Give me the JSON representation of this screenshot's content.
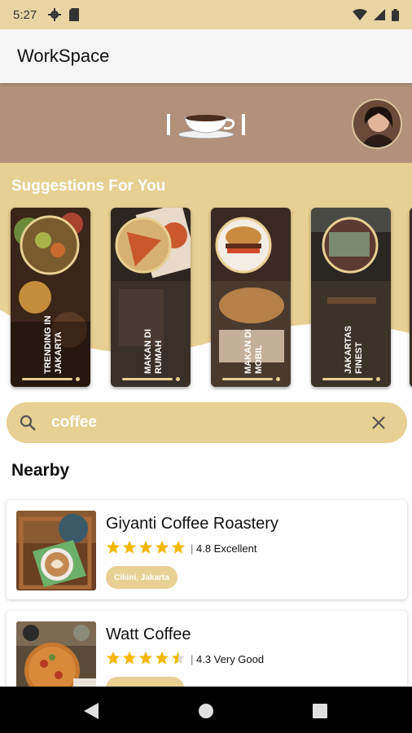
{
  "status_bar": {
    "time": "5:27",
    "left_icons": [
      "settings-icon",
      "sim-card-icon"
    ],
    "right_icons": [
      "wifi-icon",
      "signal-icon",
      "battery-icon"
    ]
  },
  "app_bar": {
    "title": "WorkSpace"
  },
  "hero": {
    "logo_icon": "coffee-cup-icon",
    "avatar_icon": "user-avatar"
  },
  "suggestions": {
    "title": "Suggestions For You",
    "items": [
      {
        "label": "TRENDING IN\nJAKARTA"
      },
      {
        "label": "MAKAN DI\nRUMAH"
      },
      {
        "label": "MAKAN DI\nMOBIL"
      },
      {
        "label": "JAKARTAS\nFINEST"
      }
    ]
  },
  "search": {
    "value": "coffee",
    "search_icon": "search-icon",
    "clear_icon": "close-icon"
  },
  "nearby": {
    "title": "Nearby",
    "places": [
      {
        "name": "Giyanti Coffee Roastery",
        "rating": 4.8,
        "rating_label": "4.8 Excellent",
        "location": "Cikini, Jakarta"
      },
      {
        "name": "Watt Coffee",
        "rating": 4.3,
        "rating_label": "4.3 Very Good",
        "location": ""
      }
    ]
  },
  "nav_bar": {
    "icons": [
      "back-icon",
      "home-icon",
      "recents-icon"
    ]
  },
  "colors": {
    "accent": "#e8cf93",
    "hero": "#b3907a",
    "star": "#f5b800"
  }
}
